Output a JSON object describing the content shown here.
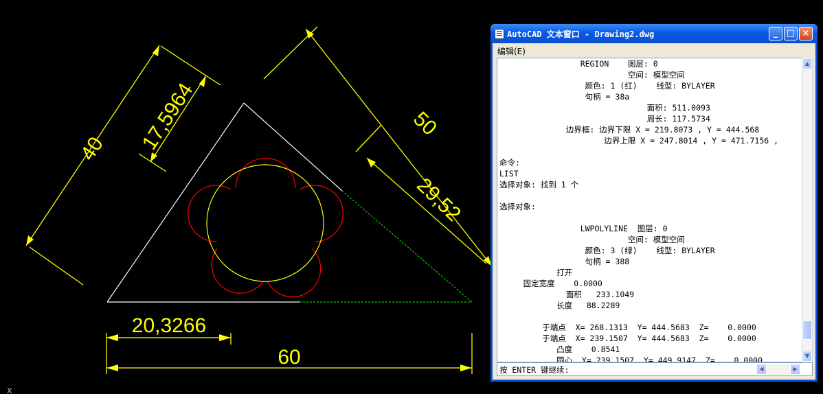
{
  "drawing": {
    "dimensions": {
      "d40": "40",
      "d17": "17,5964",
      "d50": "50",
      "d29": "29,52",
      "d20": "20,3266",
      "d60": "60"
    },
    "colors": {
      "dimension": "#ffff00",
      "triangle": "#ffffff",
      "circle": "#ffff00",
      "arcs": "#ff0000",
      "polyline": "#00cc00"
    },
    "ucs_label": "X"
  },
  "text_window": {
    "title": "AutoCAD 文本窗口 - Drawing2.dwg",
    "title_buttons": {
      "minimize": "_",
      "maximize": "□",
      "close": "×"
    },
    "menu": {
      "edit": "编辑(E)"
    },
    "lines": [
      "                 REGION    图层: 0",
      "                           空间: 模型空间",
      "                  颜色: 1 (红)    线型: BYLAYER",
      "                  句柄 = 38a",
      "                               面积: 511.0093",
      "                               周长: 117.5734",
      "              边界框: 边界下限 X = 219.8073 , Y = 444.568",
      "                      边界上限 X = 247.8014 , Y = 471.7156 ,",
      "",
      "命令:",
      "LIST",
      "选择对象: 找到 1 个",
      "",
      "选择对象:",
      "",
      "                 LWPOLYLINE  图层: 0",
      "                           空间: 模型空间",
      "                  颜色: 3 (绿)    线型: BYLAYER",
      "                  句柄 = 388",
      "            打开",
      "     固定宽度    0.0000",
      "              面积   233.1049",
      "            长度   88.2289",
      "",
      "         于端点  X= 268.1313  Y= 444.5683  Z=    0.0000",
      "         于端点  X= 239.1507  Y= 444.5683  Z=    0.0000",
      "            凸度    0.8541",
      "            圆心  Y= 239.1507  Y= 449.9147  Z=    0.0000"
    ],
    "command_prompt": "按 ENTER 键继续:"
  }
}
